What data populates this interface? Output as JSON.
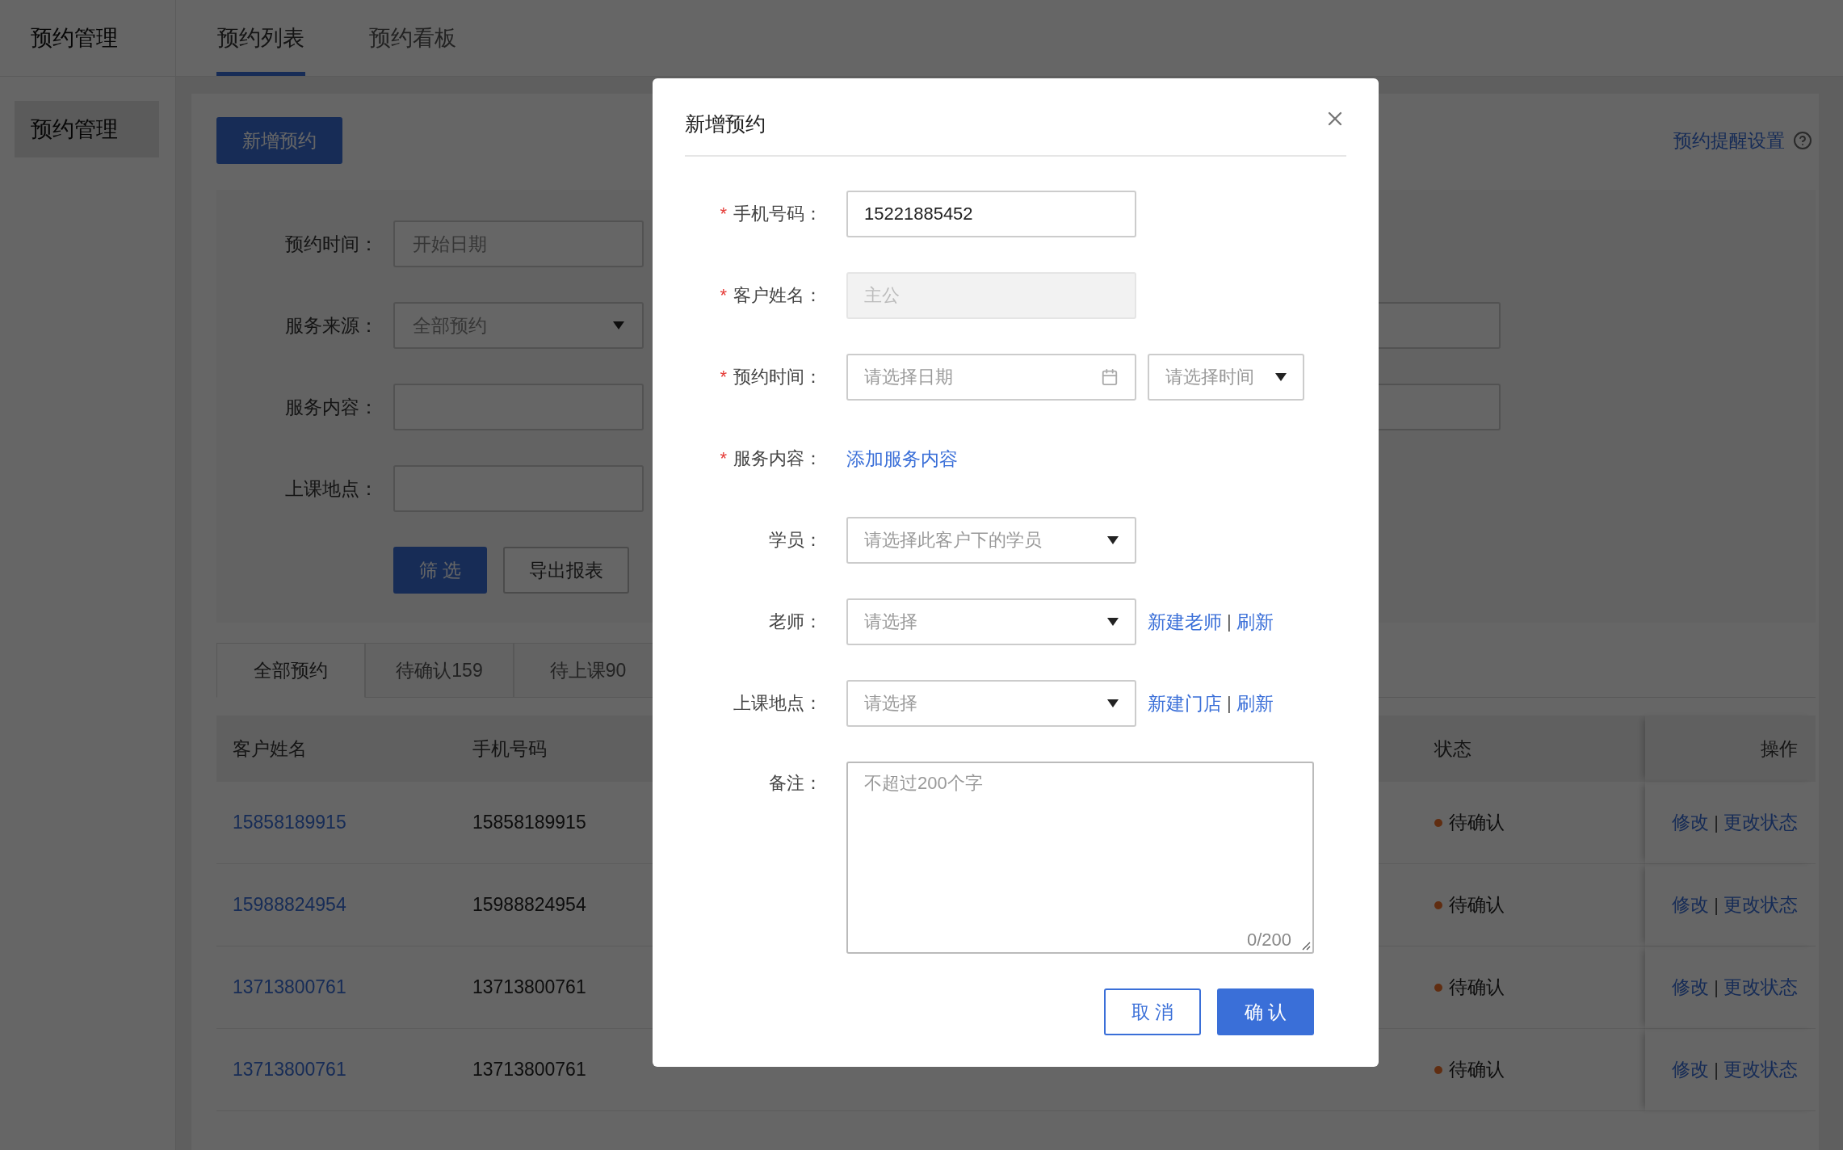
{
  "sidebar": {
    "title": "预约管理",
    "items": [
      {
        "label": "预约管理",
        "selected": true
      }
    ]
  },
  "tabs": [
    {
      "label": "预约列表",
      "selected": true
    },
    {
      "label": "预约看板",
      "selected": false
    }
  ],
  "toolbar": {
    "add_button": "新增预约",
    "reminder_link": "预约提醒设置"
  },
  "filters": [
    {
      "kind": "input",
      "label": "预约时间：",
      "placeholder": "开始日期",
      "extra_field": false
    },
    {
      "kind": "select",
      "label": "服务来源：",
      "value": "全部预约",
      "extra_field": true
    },
    {
      "kind": "input",
      "label": "服务内容：",
      "extra_field": true
    },
    {
      "kind": "input",
      "label": "上课地点：",
      "extra_field": false
    }
  ],
  "filter_buttons": [
    {
      "kind": "primary",
      "label": "筛 选"
    },
    {
      "kind": "default",
      "label": "导出报表"
    }
  ],
  "status_tabs": [
    {
      "label": "全部预约",
      "selected": true
    },
    {
      "label": "待确认159",
      "selected": false
    },
    {
      "label": "待上课90",
      "selected": false
    }
  ],
  "table": {
    "header": {
      "name": "客户姓名",
      "phone": "手机号码",
      "status": "状态",
      "actions": "操作"
    },
    "rows": [
      {
        "name": "15858189915",
        "phone": "15858189915",
        "status": "待确认",
        "actions": [
          {
            "kind": "link",
            "text": "修改"
          },
          {
            "kind": "separator",
            "text": "|"
          },
          {
            "kind": "link",
            "text": "更改状态"
          }
        ]
      },
      {
        "name": "15988824954",
        "phone": "15988824954",
        "status": "待确认",
        "actions": [
          {
            "kind": "link",
            "text": "修改"
          },
          {
            "kind": "separator",
            "text": "|"
          },
          {
            "kind": "link",
            "text": "更改状态"
          }
        ]
      },
      {
        "name": "13713800761",
        "phone": "13713800761",
        "status": "待确认",
        "actions": [
          {
            "kind": "link",
            "text": "修改"
          },
          {
            "kind": "separator",
            "text": "|"
          },
          {
            "kind": "link",
            "text": "更改状态"
          }
        ]
      },
      {
        "name": "13713800761",
        "phone": "13713800761",
        "status": "待确认",
        "actions": [
          {
            "kind": "link",
            "text": "修改"
          },
          {
            "kind": "separator",
            "text": "|"
          },
          {
            "kind": "link",
            "text": "更改状态"
          }
        ]
      }
    ]
  },
  "dialog": {
    "title": "新增预约",
    "fields": [
      {
        "kind": "input",
        "marker": "*",
        "label": "手机号码：",
        "value": "15221885452",
        "disabled": false
      },
      {
        "kind": "input",
        "marker": "*",
        "label": "客户姓名：",
        "value": "主公",
        "disabled": true
      },
      {
        "kind": "datetime",
        "marker": "*",
        "label": "预约时间：",
        "placeholder": "请选择日期",
        "time_placeholder": "请选择时间"
      },
      {
        "kind": "link",
        "marker": "*",
        "label": "服务内容：",
        "link": "添加服务内容"
      },
      {
        "kind": "select",
        "label": "学员：",
        "placeholder": "请选择此客户下的学员"
      },
      {
        "kind": "select",
        "label": "老师：",
        "placeholder": "请选择",
        "links": [
          {
            "kind": "link",
            "text": "新建老师"
          },
          {
            "kind": "separator",
            "text": "|"
          },
          {
            "kind": "link",
            "text": "刷新"
          }
        ]
      },
      {
        "kind": "select",
        "label": "上课地点：",
        "placeholder": "请选择",
        "links": [
          {
            "kind": "link",
            "text": "新建门店"
          },
          {
            "kind": "separator",
            "text": "|"
          },
          {
            "kind": "link",
            "text": "刷新"
          }
        ]
      },
      {
        "kind": "textarea",
        "label": "备注：",
        "placeholder": "不超过200个字",
        "counter": "0/200"
      }
    ],
    "buttons": [
      {
        "kind": "secondary",
        "label": "取 消"
      },
      {
        "kind": "primary",
        "label": "确 认"
      }
    ]
  }
}
